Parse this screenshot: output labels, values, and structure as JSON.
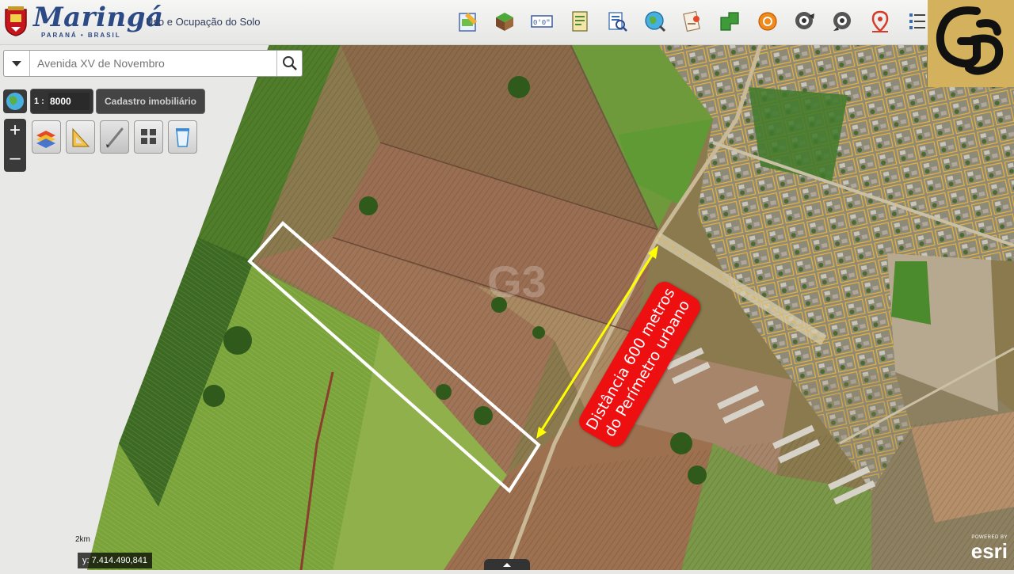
{
  "header": {
    "logo_text": "Maringá",
    "logo_subtext": "PARANÁ • BRASIL",
    "app_title": "Uso e Ocupação do Solo",
    "toolbar_icons": [
      "edit-map-icon",
      "3d-cube-icon",
      "coordinates-icon",
      "notes-icon",
      "search-document-icon",
      "globe-search-icon",
      "report-icon",
      "route-icon",
      "sync-icon",
      "street-view-icon",
      "street-view-icon",
      "location-pin-icon",
      "legend-list-icon"
    ]
  },
  "badge": {
    "logo": "G3"
  },
  "search": {
    "value": "",
    "placeholder": "Avenida XV de Novembro"
  },
  "scale": {
    "prefix": "1 :",
    "value": "8000"
  },
  "layer_button": {
    "label": "Cadastro imobiliário"
  },
  "zoom": {
    "in": "+",
    "out": "–"
  },
  "map_tools": [
    "layers-icon",
    "measure-icon",
    "draw-icon",
    "basemap-grid-icon",
    "clear-icon"
  ],
  "coordinates": {
    "text": "y: 7.414.490,841"
  },
  "scalebar": {
    "label": "2km"
  },
  "annotation": {
    "line1": "Distância 600 metros",
    "line2": "do Perímetro urbano",
    "label_color": "#ee1010",
    "arrow_color": "#ffff00",
    "parcel_outline_color": "#ffffff"
  },
  "attribution": {
    "powered": "POWERED BY",
    "brand": "esri"
  },
  "colors": {
    "gold_badge": "#d3b15d",
    "brand_blue": "#2c4a86",
    "parcel_lines": "#e8b23a"
  }
}
